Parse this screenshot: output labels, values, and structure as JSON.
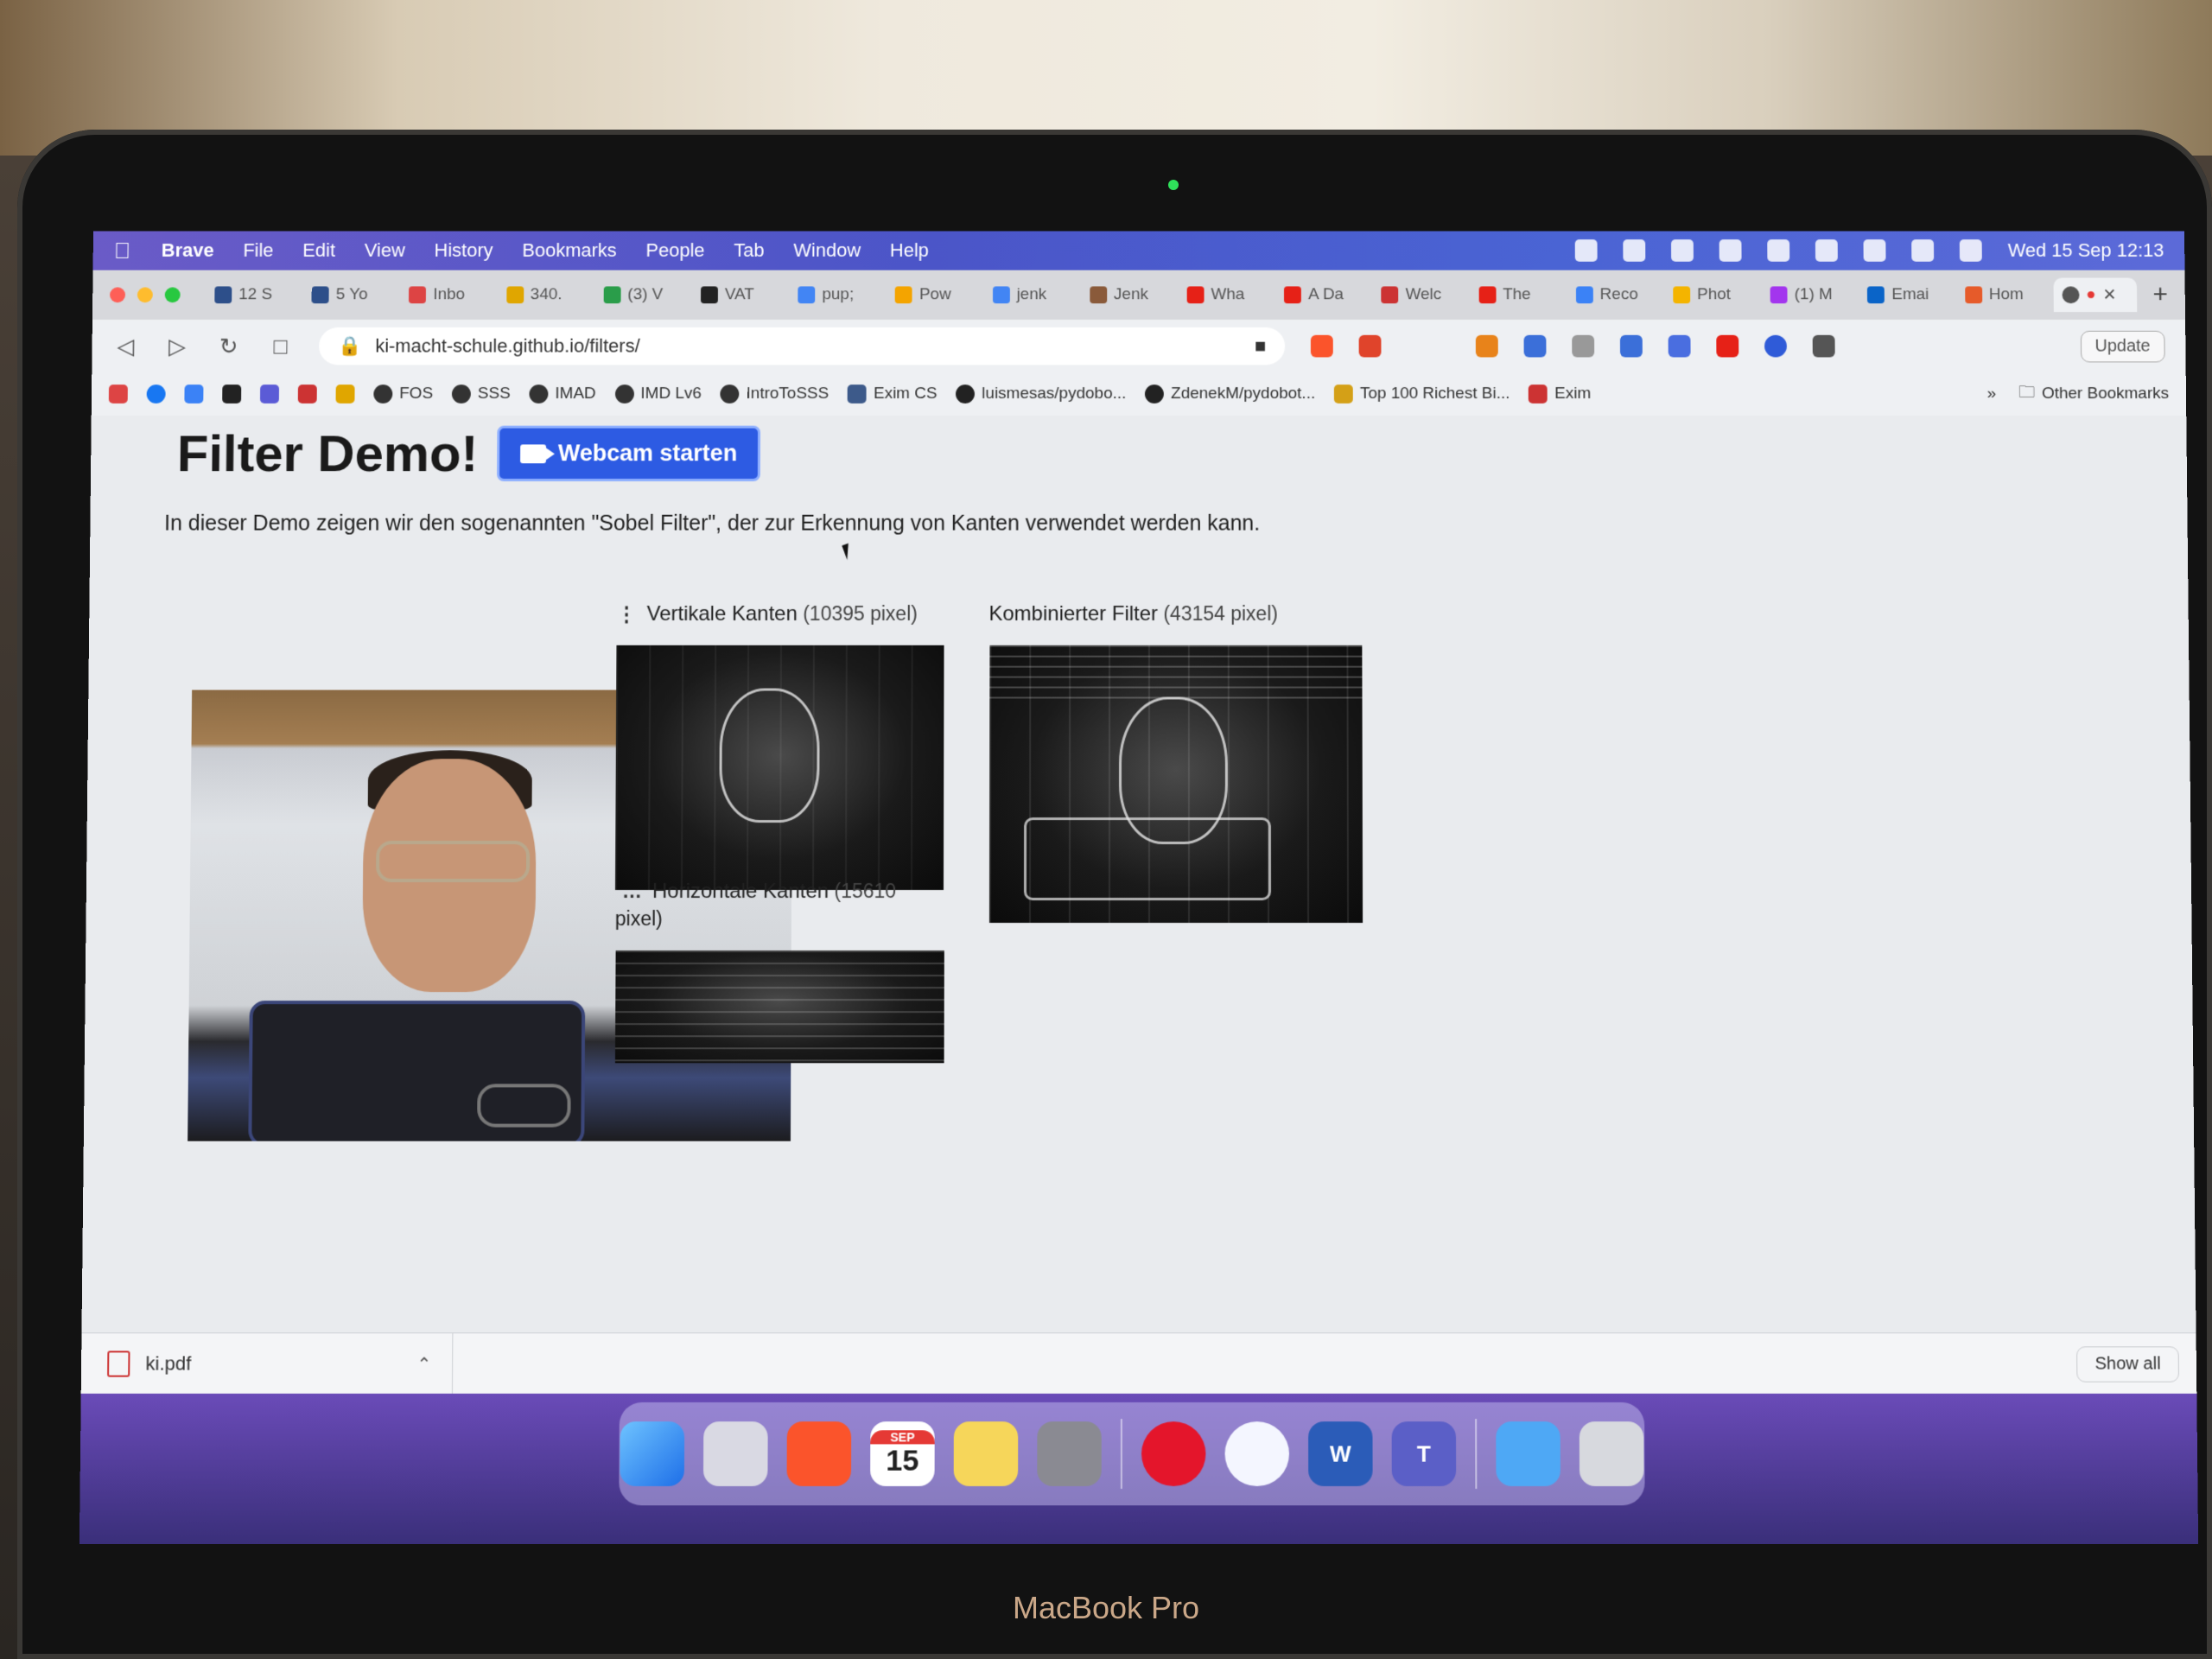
{
  "menubar": {
    "items": [
      "Brave",
      "File",
      "Edit",
      "View",
      "History",
      "Bookmarks",
      "People",
      "Tab",
      "Window",
      "Help"
    ],
    "clock": "Wed 15 Sep 12:13"
  },
  "tabs": [
    "12 S",
    "5 Yo",
    "Inbo",
    "340.",
    "(3) V",
    "VAT",
    "pup;",
    "Pow",
    "jenk",
    "Jenk",
    "Wha",
    "A Da",
    "Welc",
    "The",
    "Reco",
    "Phot",
    "(1) M",
    "Emai",
    "Hom"
  ],
  "toolbar": {
    "url": "ki-macht-schule.github.io/filters/",
    "update_label": "Update"
  },
  "bookmarks": {
    "items": [
      "FOS",
      "SSS",
      "IMAD",
      "IMD Lv6",
      "IntroToSSS",
      "Exim CS",
      "luismesas/pydobo...",
      "ZdenekM/pydobot...",
      "Top 100 Richest Bi...",
      "Exim"
    ],
    "more": "»",
    "other": "Other Bookmarks"
  },
  "page": {
    "title": "Filter Demo!",
    "webcam_button": "Webcam starten",
    "intro": "In dieser Demo zeigen wir den sogenannten \"Sobel Filter\", der zur Erkennung von Kanten verwendet werden kann.",
    "vertical": {
      "name": "Vertikale Kanten",
      "count": "(10395 pixel)"
    },
    "horizontal": {
      "name": "Horizontale Kanten",
      "count": "(15610",
      "count2": "pixel)"
    },
    "combined": {
      "name": "Kombinierter Filter",
      "count": "(43154 pixel)"
    }
  },
  "download": {
    "file": "ki.pdf",
    "show_all": "Show all"
  },
  "dock": {
    "calendar_month": "SEP",
    "calendar_day": "15"
  },
  "brand": "MacBook Pro",
  "colors": {
    "accent": "#2d5be3",
    "menubar": "#4b55c8"
  }
}
